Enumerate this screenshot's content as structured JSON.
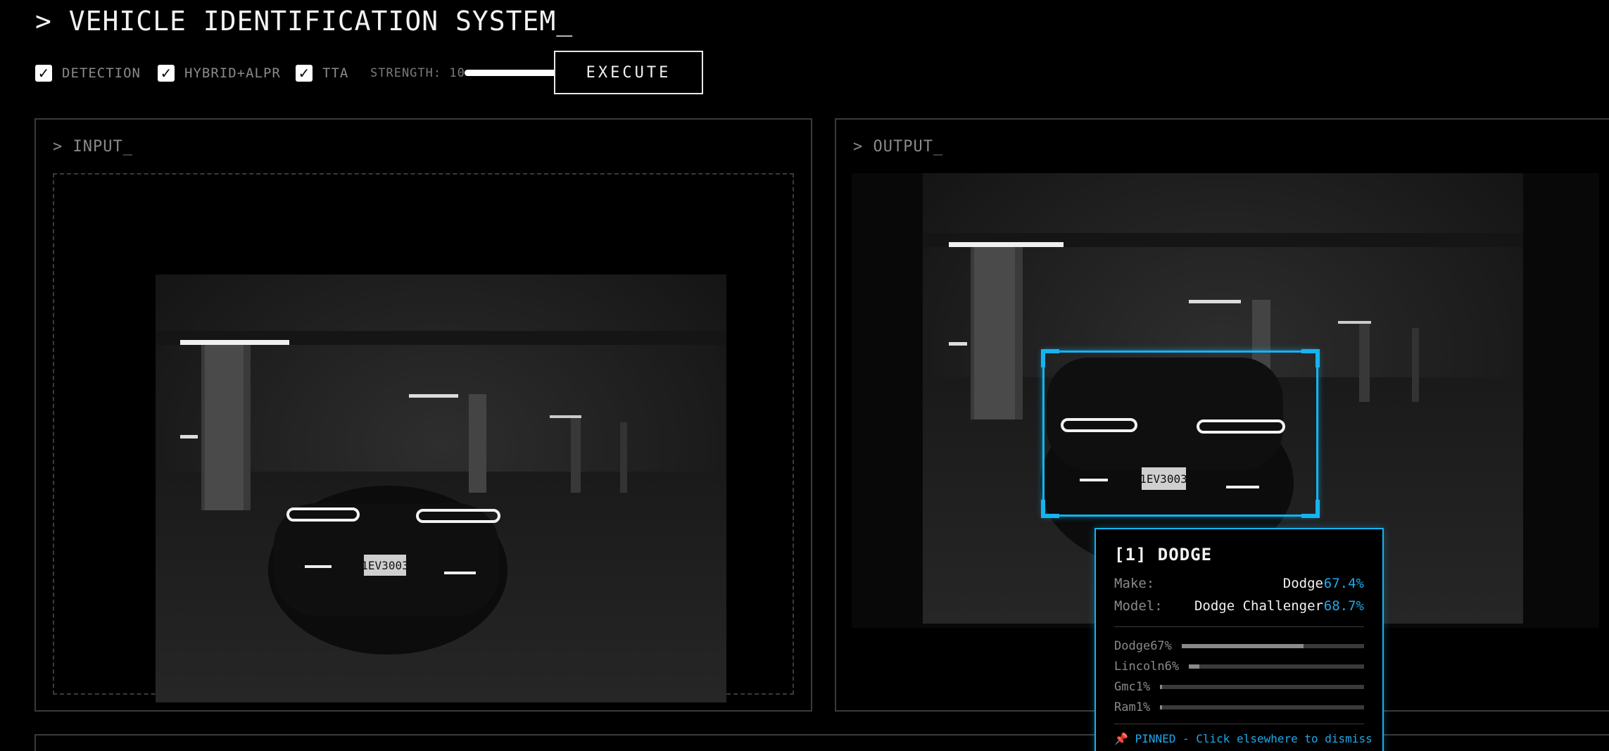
{
  "header": {
    "title": "> VEHICLE IDENTIFICATION SYSTEM_"
  },
  "controls": {
    "checkboxes": [
      {
        "label": "DETECTION",
        "checked": true
      },
      {
        "label": "HYBRID+ALPR",
        "checked": true
      },
      {
        "label": "TTA",
        "checked": true
      }
    ],
    "strength_label": "STRENGTH: 10",
    "strength_value": 10,
    "strength_max": 10,
    "execute_label": "EXECUTE"
  },
  "input_panel": {
    "title": "> INPUT_"
  },
  "output_panel": {
    "title": "> OUTPUT_"
  },
  "plate_text": "1EV3003",
  "colors": {
    "accent": "#14b4f0",
    "border": "#3a3a3a",
    "muted": "#8a8a8a"
  },
  "tooltip": {
    "title": "[1] DODGE",
    "make_label": "Make:",
    "make_value": "Dodge",
    "make_conf": "67.4%",
    "model_label": "Model:",
    "model_value": "Dodge Challenger",
    "model_conf": "68.7%",
    "bars": [
      {
        "label": "Dodge",
        "pct": "67%",
        "value": 0.67
      },
      {
        "label": "Lincoln",
        "pct": "6%",
        "value": 0.06
      },
      {
        "label": "Gmc",
        "pct": "1%",
        "value": 0.01
      },
      {
        "label": "Ram",
        "pct": "1%",
        "value": 0.01
      }
    ],
    "pinned_icon": "pin-icon",
    "pinned_text": "📌 PINNED - Click elsewhere to dismiss"
  }
}
